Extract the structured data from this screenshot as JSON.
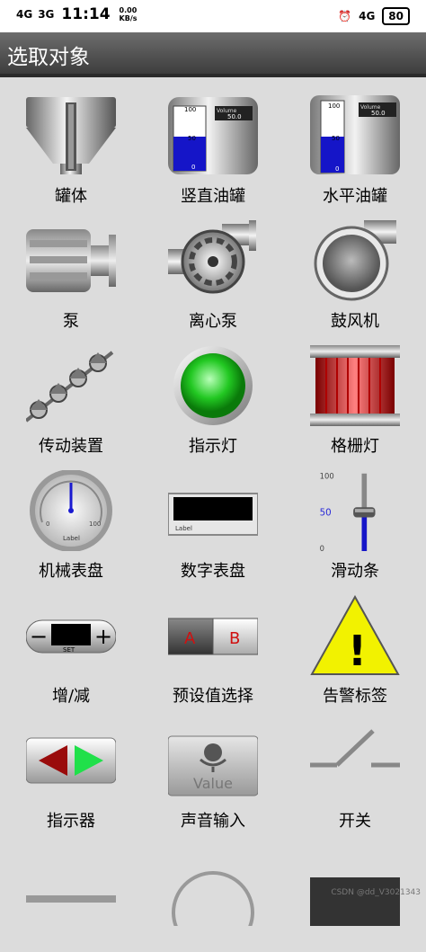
{
  "status_bar": {
    "network_left": "4G",
    "network_left2": "3G",
    "time": "11:14",
    "speed_value": "0.00",
    "speed_unit": "KB/s",
    "network_right": "4G",
    "battery": "80"
  },
  "app_bar": {
    "title": "选取对象"
  },
  "items": [
    {
      "label": "罐体",
      "icon": "tank-icon"
    },
    {
      "label": "竖直油罐",
      "icon": "vertical-oil-tank-icon",
      "gauge_top": "100",
      "gauge_mid": "50",
      "gauge_bottom": "0",
      "volume_label": "Volume",
      "volume_value": "50.0",
      "level": 0.5
    },
    {
      "label": "水平油罐",
      "icon": "horizontal-oil-tank-icon",
      "gauge_top": "100",
      "gauge_mid": "50",
      "gauge_bottom": "0",
      "volume_label": "Volume",
      "volume_value": "50.0",
      "level": 0.5
    },
    {
      "label": "泵",
      "icon": "pump-icon"
    },
    {
      "label": "离心泵",
      "icon": "centrifugal-pump-icon"
    },
    {
      "label": "鼓风机",
      "icon": "blower-icon"
    },
    {
      "label": "传动装置",
      "icon": "conveyor-icon"
    },
    {
      "label": "指示灯",
      "icon": "indicator-light-icon",
      "color": "#22c822"
    },
    {
      "label": "格栅灯",
      "icon": "grille-light-icon",
      "color": "#e02020"
    },
    {
      "label": "机械表盘",
      "icon": "mechanical-dial-icon",
      "dial_min": "0",
      "dial_max": "100",
      "dial_label": "Label"
    },
    {
      "label": "数字表盘",
      "icon": "digital-dial-icon",
      "dial_label": "Label"
    },
    {
      "label": "滑动条",
      "icon": "slider-icon",
      "tick_top": "100",
      "tick_mid": "50",
      "tick_bottom": "0",
      "value": 50
    },
    {
      "label": "增/减",
      "icon": "increment-decrement-icon",
      "set_label": "SET",
      "minus": "−",
      "plus": "+"
    },
    {
      "label": "预设值选择",
      "icon": "preset-selector-icon",
      "option_a": "A",
      "option_b": "B"
    },
    {
      "label": "告警标签",
      "icon": "warning-label-icon",
      "mark": "!"
    },
    {
      "label": "指示器",
      "icon": "direction-indicator-icon"
    },
    {
      "label": "声音输入",
      "icon": "voice-input-icon",
      "value_text": "Value"
    },
    {
      "label": "开关",
      "icon": "switch-icon"
    }
  ],
  "watermark": "CSDN @dd_V3021343"
}
